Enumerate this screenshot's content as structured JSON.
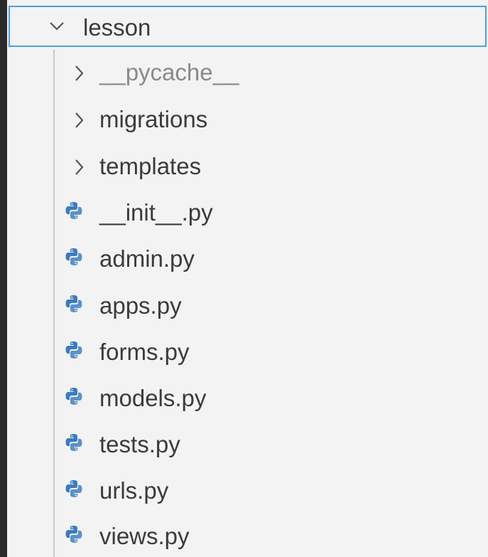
{
  "explorer": {
    "root_folder": {
      "label": "lesson",
      "expanded": true,
      "icon": "chevron-down-icon"
    },
    "items": [
      {
        "label": "__pycache__",
        "kind": "folder",
        "icon": "chevron-right-icon",
        "dimmed": true
      },
      {
        "label": "migrations",
        "kind": "folder",
        "icon": "chevron-right-icon"
      },
      {
        "label": "templates",
        "kind": "folder",
        "icon": "chevron-right-icon"
      },
      {
        "label": "__init__.py",
        "kind": "file",
        "icon": "python-icon"
      },
      {
        "label": "admin.py",
        "kind": "file",
        "icon": "python-icon"
      },
      {
        "label": "apps.py",
        "kind": "file",
        "icon": "python-icon"
      },
      {
        "label": "forms.py",
        "kind": "file",
        "icon": "python-icon"
      },
      {
        "label": "models.py",
        "kind": "file",
        "icon": "python-icon"
      },
      {
        "label": "tests.py",
        "kind": "file",
        "icon": "python-icon"
      },
      {
        "label": "urls.py",
        "kind": "file",
        "icon": "python-icon"
      },
      {
        "label": "views.py",
        "kind": "file",
        "icon": "python-icon"
      }
    ]
  },
  "colors": {
    "background": "#f3f3f3",
    "focus_border": "#4f9ee0",
    "text": "#3b3b3b",
    "dim_text": "#8a8a8a",
    "python_icon": "#3d7bbf"
  }
}
